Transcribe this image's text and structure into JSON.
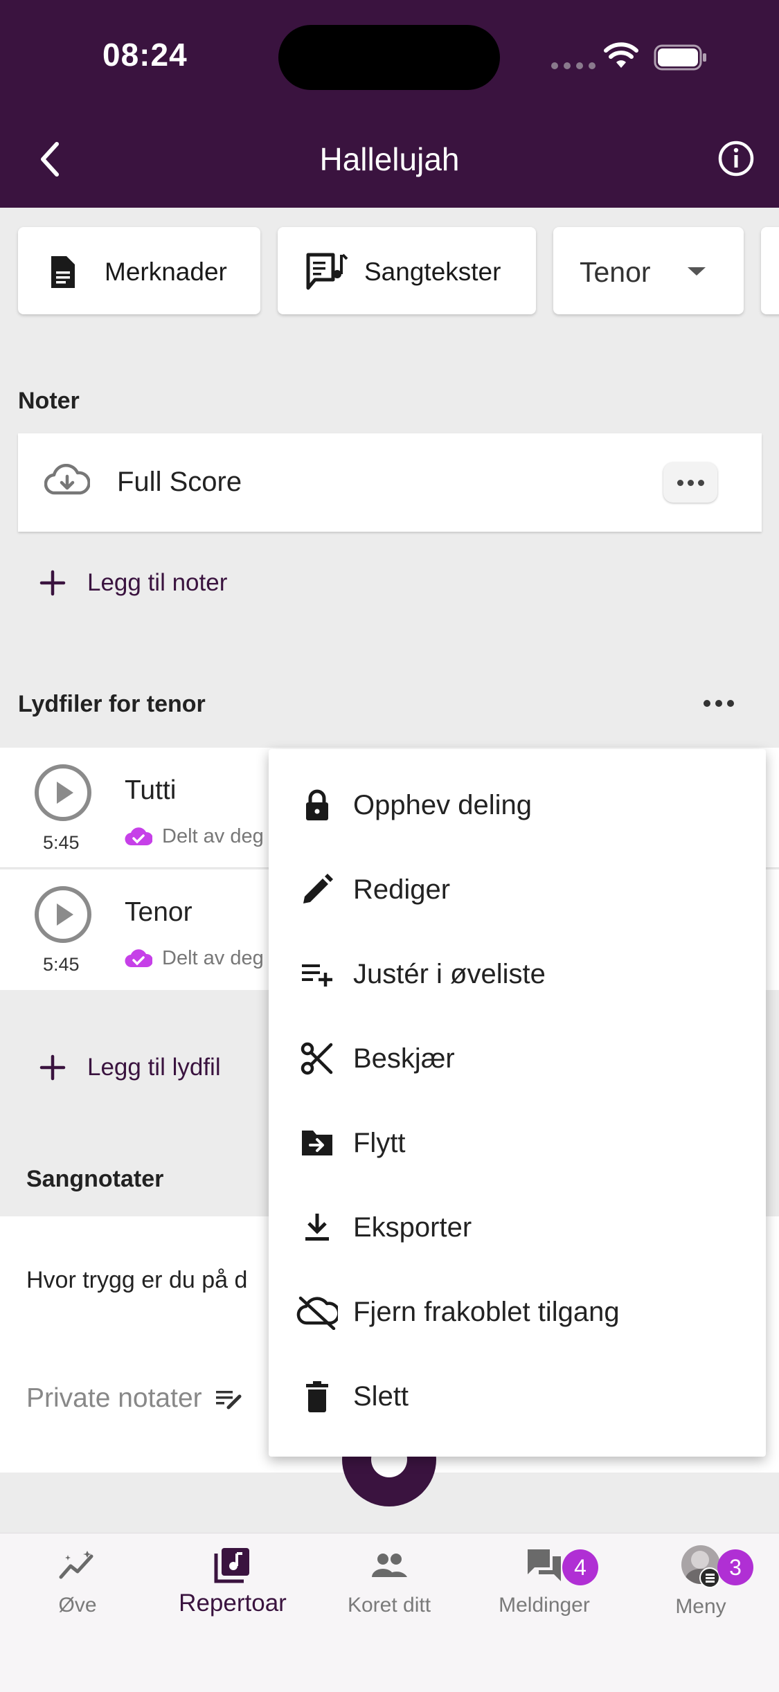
{
  "status_bar": {
    "time": "08:24"
  },
  "header": {
    "title": "Hallelujah"
  },
  "chips": {
    "notes_label": "Merknader",
    "lyrics_label": "Sangtekster",
    "voice_selected": "Tenor"
  },
  "sheet_music": {
    "section_title": "Noter",
    "items": [
      {
        "title": "Full Score"
      }
    ],
    "add_label": "Legg til noter"
  },
  "audio": {
    "section_title": "Lydfiler for tenor",
    "items": [
      {
        "title": "Tutti",
        "duration": "5:45",
        "shared_text": "Delt av deg"
      },
      {
        "title": "Tenor",
        "duration": "5:45",
        "shared_text": "Delt av deg"
      }
    ],
    "add_label": "Legg til lydfil"
  },
  "song_notes": {
    "section_title": "Sangnotater",
    "question": "Hvor trygg er du på d",
    "private_placeholder": "Private notater"
  },
  "context_menu": {
    "items": [
      {
        "label": "Opphev deling",
        "icon": "lock-icon"
      },
      {
        "label": "Rediger",
        "icon": "pencil-icon"
      },
      {
        "label": "Justér i øveliste",
        "icon": "playlist-add-icon"
      },
      {
        "label": "Beskjær",
        "icon": "scissors-icon"
      },
      {
        "label": "Flytt",
        "icon": "folder-move-icon"
      },
      {
        "label": "Eksporter",
        "icon": "download-icon"
      },
      {
        "label": "Fjern frakoblet tilgang",
        "icon": "cloud-off-icon"
      },
      {
        "label": "Slett",
        "icon": "trash-icon"
      }
    ]
  },
  "bottom_nav": {
    "tabs": [
      {
        "label": "Øve"
      },
      {
        "label": "Repertoar"
      },
      {
        "label": "Koret ditt"
      },
      {
        "label": "Meldinger",
        "badge": "4"
      },
      {
        "label": "Meny",
        "badge": "3"
      }
    ]
  },
  "colors": {
    "brand": "#3a133f",
    "badge": "#b02fd4",
    "shared_check": "#c640e8"
  }
}
